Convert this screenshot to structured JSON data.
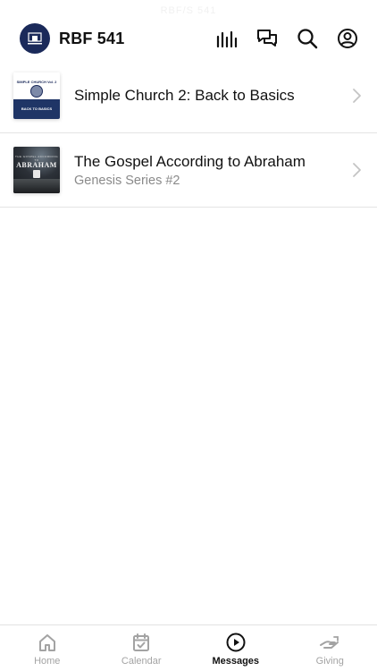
{
  "status_ghost_text": "RBF/S 541",
  "header": {
    "app_title": "RBF 541",
    "actions": [
      {
        "icon": "equalizer-icon"
      },
      {
        "icon": "chat-icon"
      },
      {
        "icon": "search-icon"
      },
      {
        "icon": "profile-icon"
      }
    ]
  },
  "messages": [
    {
      "title": "Simple Church 2: Back to Basics",
      "subtitle": "",
      "thumb_top_text": "SIMPLE CHURCH Vol. 2",
      "thumb_band_text": "BACK TO BASICS"
    },
    {
      "title": "The Gospel According to Abraham",
      "subtitle": "Genesis Series #2",
      "thumb_small_text": "THE GOSPEL ACCORDING TO",
      "thumb_title_text": "ABRAHAM"
    }
  ],
  "tabs": [
    {
      "label": "Home",
      "icon": "home-icon",
      "active": false
    },
    {
      "label": "Calendar",
      "icon": "calendar-icon",
      "active": false
    },
    {
      "label": "Messages",
      "icon": "play-circle-icon",
      "active": true
    },
    {
      "label": "Giving",
      "icon": "giving-hand-icon",
      "active": false
    }
  ],
  "colors": {
    "brand_navy": "#1b2a5a",
    "text_primary": "#111111",
    "text_secondary": "#8a8a8a",
    "tab_inactive": "#a3a3a3",
    "divider": "#e4e4e4"
  }
}
